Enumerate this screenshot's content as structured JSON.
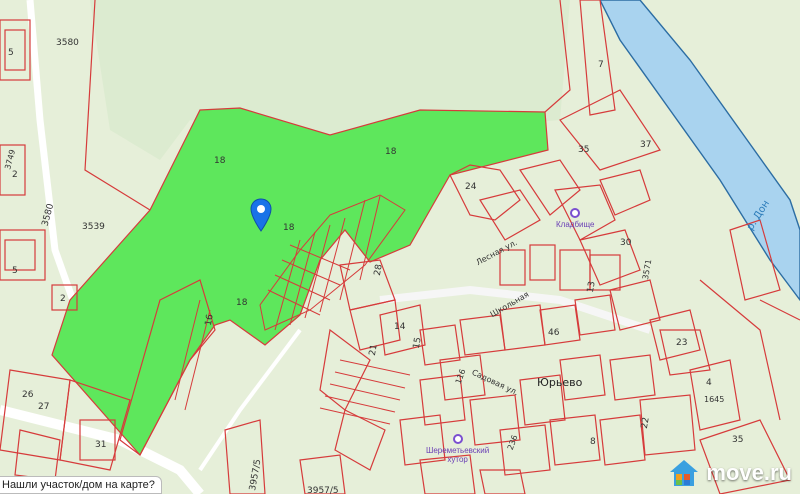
{
  "map": {
    "labels": {
      "l3580a": "3580",
      "l3580b": "3580",
      "l3539": "3539",
      "l18a": "18",
      "l18b": "18",
      "l18c": "18",
      "l18d": "18",
      "l16": "16",
      "l7": "7",
      "l35a": "35",
      "l37": "37",
      "l35b": "35",
      "l3957": "3957/5",
      "l3957b": "3957/5",
      "l5a": "5",
      "l5b": "5",
      "l2a": "2",
      "l2b": "2",
      "l3749": "3749",
      "l26": "26",
      "l27": "27",
      "l31": "31",
      "l30": "30",
      "l23": "23",
      "l4": "4",
      "l1645": "1645",
      "l22": "22",
      "l8": "8",
      "l14": "14",
      "l13": "13",
      "l15": "15",
      "l46": "46",
      "l21": "21",
      "l24": "24",
      "l28": "28",
      "l3571": "3571",
      "l116": "116",
      "l236": "236"
    },
    "village": "Юрьево",
    "river": "р. Дон",
    "poi": [
      {
        "name": "Кладбище",
        "sub": ""
      },
      {
        "name": "Шереметьевский",
        "sub": "хутор"
      }
    ],
    "streets": {
      "lesnaya": "Лесная ул.",
      "sadovaya": "Садовая ул.",
      "school": "Школьная"
    }
  },
  "pin": {
    "color": "#1a73e8"
  },
  "brand": {
    "name": "move.ru"
  },
  "footer": {
    "question": "Нашли участок/дом на карте?"
  },
  "colors": {
    "forest": "#e4efd9",
    "highlight": "#5ee75c",
    "parcel": "#d63b3b",
    "river": "#a9d3ef",
    "road": "#ffffff"
  }
}
